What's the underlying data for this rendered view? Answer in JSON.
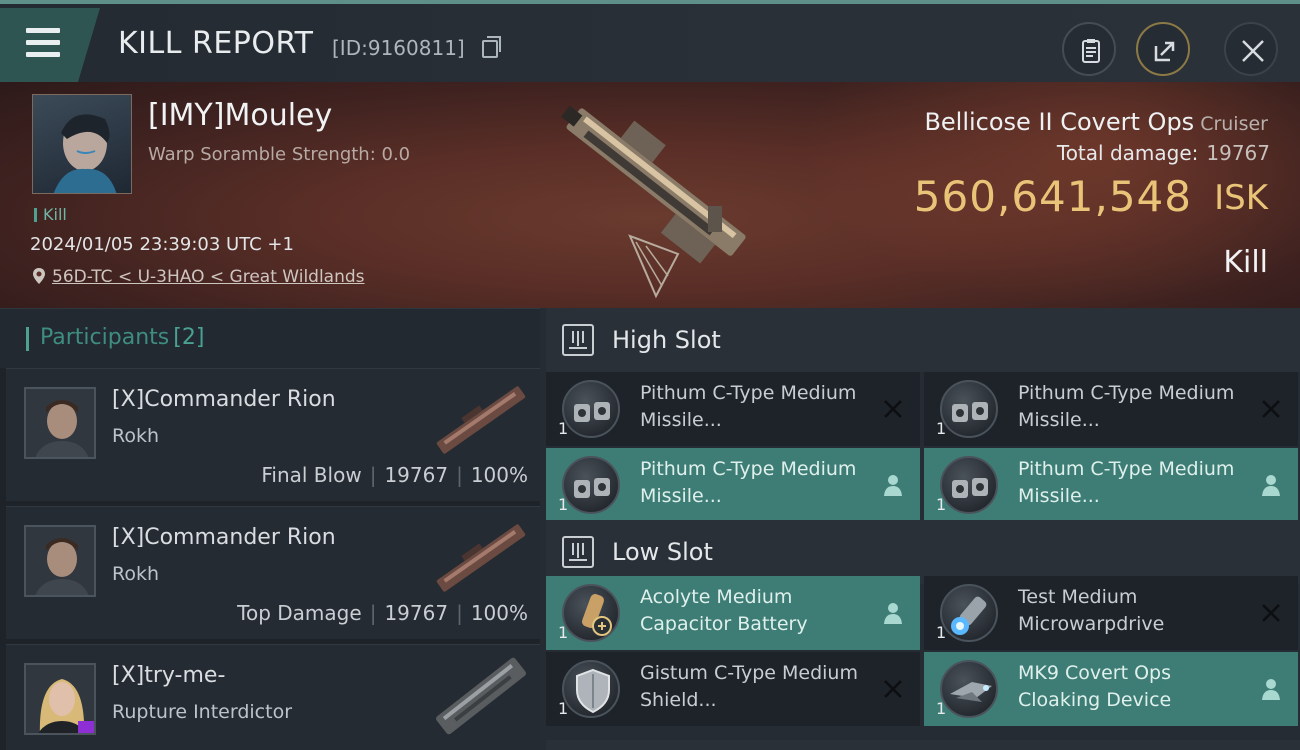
{
  "header": {
    "title": "KILL REPORT",
    "report_id": "[ID:9160811]",
    "menu_icon": "hamburger-menu-icon",
    "clipboard_icon": "clipboard-icon",
    "share_icon": "share-export-icon",
    "close_icon": "close-icon"
  },
  "victim": {
    "name": "[IMY]Mouley",
    "scramble": "Warp Soramble Strength: 0.0",
    "tag": "Kill",
    "datetime": "2024/01/05 23:39:03 UTC +1",
    "location": "56D-TC < U-3HAO < Great Wildlands",
    "location_icon": "map-pin-icon",
    "ship": "Bellicose II Covert Ops",
    "ship_class": "Cruiser",
    "total_damage_label": "Total damage:",
    "total_damage": "19767",
    "isk_value": "560,641,548",
    "isk_unit": "ISK",
    "result": "Kill"
  },
  "participants": {
    "title": "Participants",
    "count": "[2]",
    "rows": [
      {
        "name": "[X]Commander Rion",
        "ship": "Rokh",
        "role": "Final Blow",
        "damage": "19767",
        "percent": "100%"
      },
      {
        "name": "[X]Commander Rion",
        "ship": "Rokh",
        "role": "Top Damage",
        "damage": "19767",
        "percent": "100%"
      },
      {
        "name": "[X]try-me-",
        "ship": "Rupture Interdictor",
        "role": "",
        "damage": "",
        "percent": ""
      }
    ]
  },
  "slots": {
    "high": {
      "title": "High Slot",
      "modules": [
        {
          "name": "Pithum C-Type Medium Missile...",
          "qty": "1",
          "status": "destroyed"
        },
        {
          "name": "Pithum C-Type Medium Missile...",
          "qty": "1",
          "status": "destroyed"
        },
        {
          "name": "Pithum C-Type Medium Missile...",
          "qty": "1",
          "status": "dropped"
        },
        {
          "name": "Pithum C-Type Medium Missile...",
          "qty": "1",
          "status": "dropped"
        }
      ]
    },
    "low": {
      "title": "Low Slot",
      "modules": [
        {
          "name": "Acolyte Medium Capacitor Battery",
          "qty": "1",
          "status": "dropped"
        },
        {
          "name": "Test Medium Microwarpdrive",
          "qty": "1",
          "status": "destroyed"
        },
        {
          "name": "Gistum C-Type Medium Shield...",
          "qty": "1",
          "status": "destroyed"
        },
        {
          "name": "MK9 Covert Ops Cloaking Device",
          "qty": "1",
          "status": "dropped"
        }
      ]
    }
  },
  "colors": {
    "accent_teal": "#3e7d75",
    "isk_gold": "#e9c478",
    "panel_dark": "#1e2329"
  }
}
